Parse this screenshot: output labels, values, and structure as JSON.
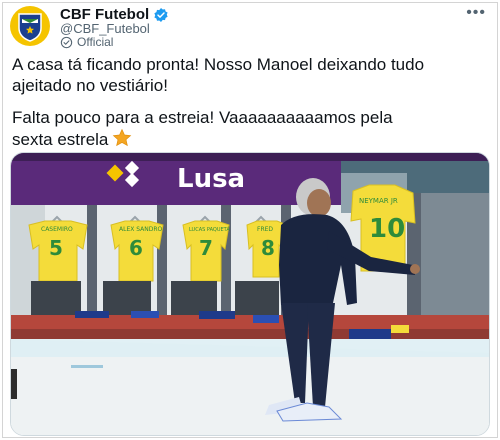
{
  "account": {
    "display_name": "CBF Futebol",
    "handle": "@CBF_Futebol",
    "label": "Official",
    "verified_icon": "verified-badge-icon",
    "label_icon": "official-label-icon",
    "brand_color": "#f5c400",
    "verified_color": "#1d9bf0"
  },
  "tweet": {
    "paragraph_1": "A casa tá ficando pronta! Nosso Manoel deixando tudo\najeitado no vestiário!",
    "paragraph_2": "Falta pouco para a estreia! Vaaaaaaaaaamos pela\nsexta estrela",
    "emoji": "star"
  },
  "media": {
    "banner_text": "Lusa",
    "jersey_numbers": [
      "5",
      "6",
      "7",
      "8",
      "10"
    ],
    "jersey_names": [
      "CASEMIRO",
      "ALEX SANDRO",
      "LUCAS PAQUETÁ",
      "FRED",
      "NEYMAR JR"
    ],
    "jersey_color": "#f4dc3a",
    "number_color": "#2e8b3a"
  },
  "actions": {
    "more_icon": "more-options-icon"
  }
}
